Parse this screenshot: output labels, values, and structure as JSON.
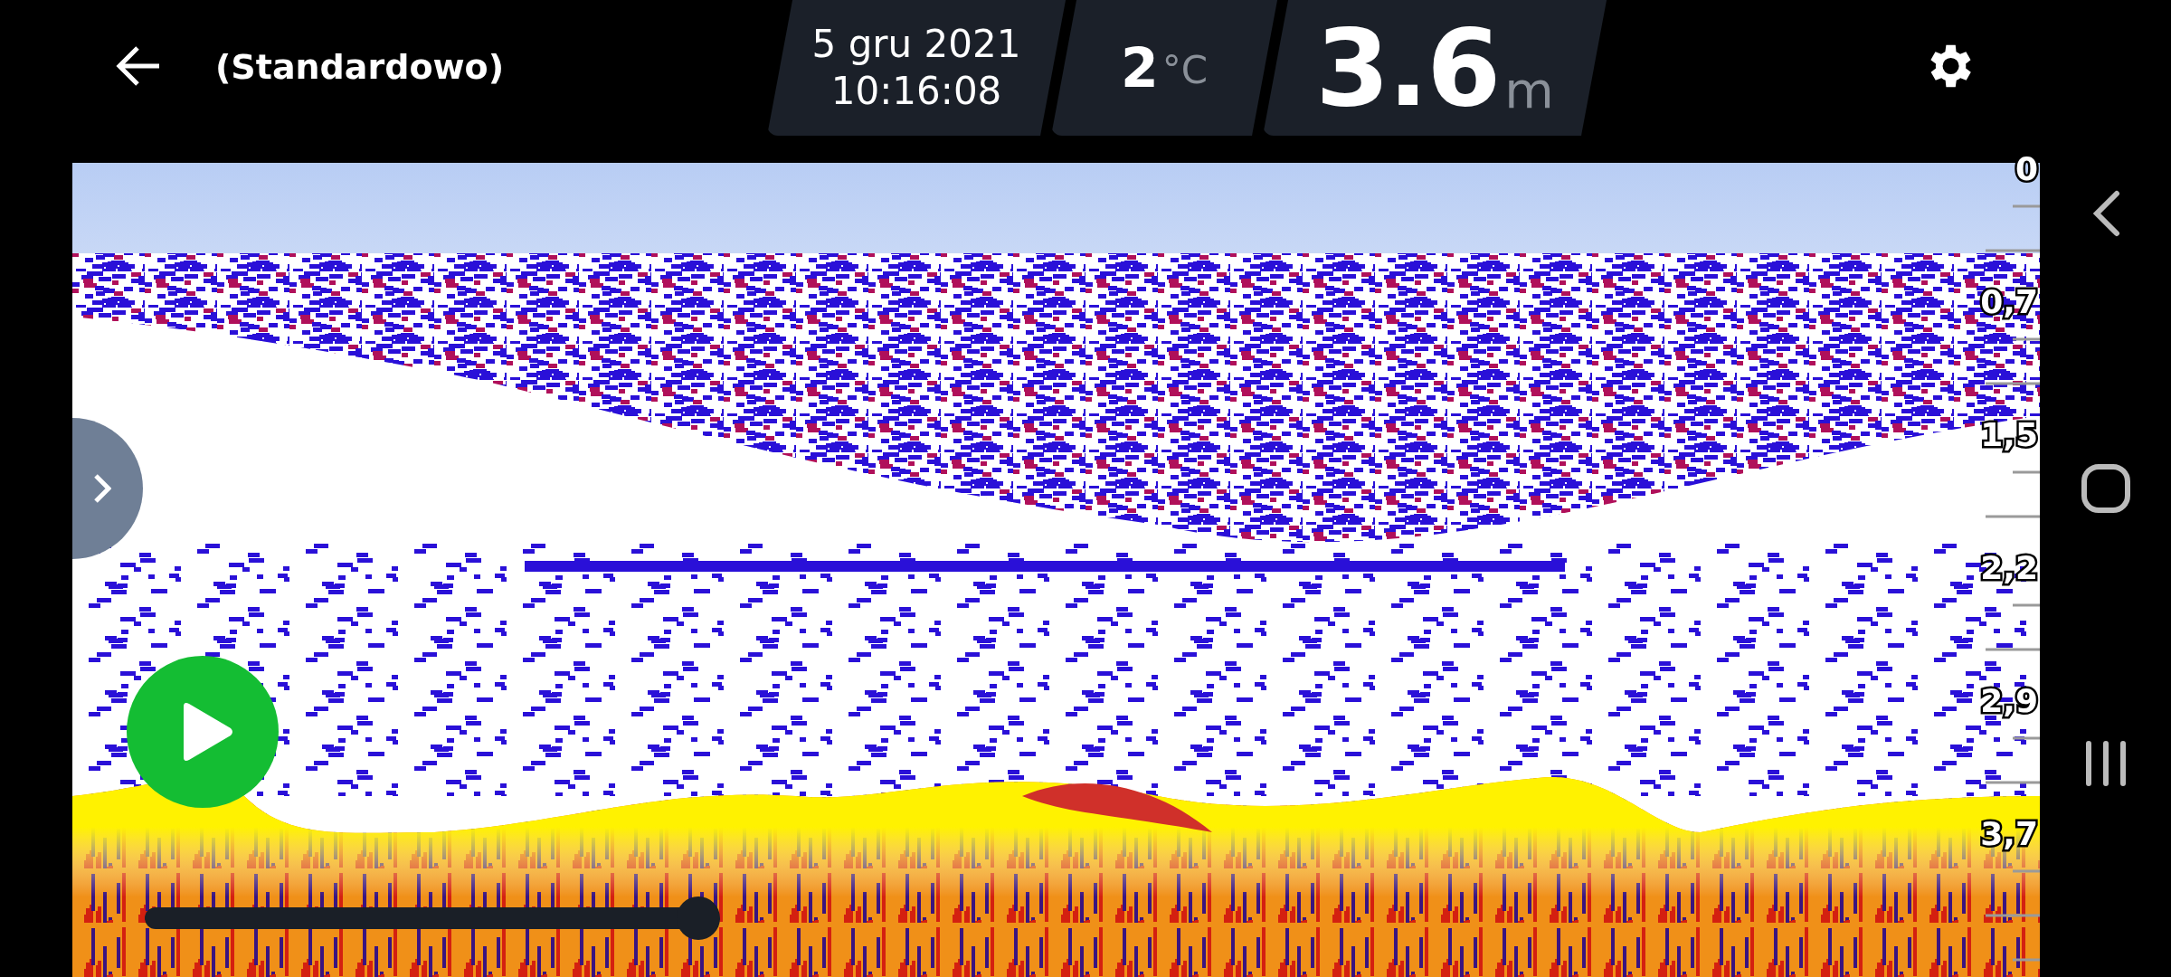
{
  "header": {
    "title": "(Standardowo)",
    "date": "5 gru 2021",
    "time": "10:16:08",
    "temperature": {
      "value": "2",
      "unit": "°C"
    },
    "depth": {
      "value": "3.6",
      "unit": "m"
    }
  },
  "depth_scale": [
    "0",
    "0,7",
    "1,5",
    "2,2",
    "2,9",
    "3,7"
  ],
  "playback": {
    "level": 1
  }
}
